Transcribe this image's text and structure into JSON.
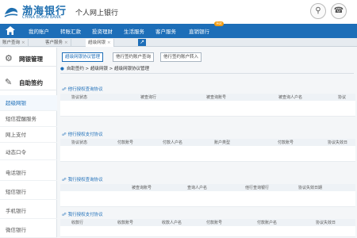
{
  "header": {
    "brand_cn": "渤海银行",
    "brand_en": "CHINA BOHAI BANK",
    "app_title": "个人网上银行",
    "colors": {
      "brand": "#1f6fb0",
      "nav": "#1d6eb8",
      "hot_badge": "#f39c12"
    }
  },
  "nav": {
    "items": [
      "我的账户",
      "转账汇款",
      "投资理财",
      "生活服务",
      "客户服务",
      "直销银行"
    ],
    "hot_badge": "Hot"
  },
  "tabs": [
    {
      "label": "账户查询"
    },
    {
      "label": "客户服务"
    },
    {
      "label": "超级网银"
    }
  ],
  "sidebar": {
    "sections": [
      {
        "icon": "gear-icon",
        "label": "网银管理"
      },
      {
        "icon": "edit-icon",
        "label": "自助签约"
      }
    ],
    "items": [
      "超级网银",
      "短信提醒服务",
      "网上支付",
      "动态口令",
      "电话银行",
      "短信银行",
      "手机银行",
      "微信银行"
    ]
  },
  "subtabs": [
    "超级网银协议管理",
    "他行签约账户查询",
    "他行签约账户转入"
  ],
  "breadcrumb": "自助签约 > 超级网银 > 超级网银协议管理",
  "sections": [
    {
      "title": "他行授权查询协议",
      "columns": [
        "协议状态",
        "被查询行",
        "被查询账号",
        "被查询人户名",
        "协议"
      ]
    },
    {
      "title": "他行授权支付协议",
      "columns": [
        "协议状态",
        "付款账号",
        "付款人户名",
        "账户类型",
        "付款账号",
        "协议失效日"
      ]
    },
    {
      "title": "我行授权查询协议",
      "columns": [
        "被查询账号",
        "查询人户名",
        "他行查询银行",
        "协议失效日期"
      ]
    },
    {
      "title": "我行授权支付协议",
      "columns": [
        "收款行",
        "收款账号",
        "收款人户名",
        "付款账号",
        "付款账户名",
        "协议失效日"
      ]
    }
  ]
}
